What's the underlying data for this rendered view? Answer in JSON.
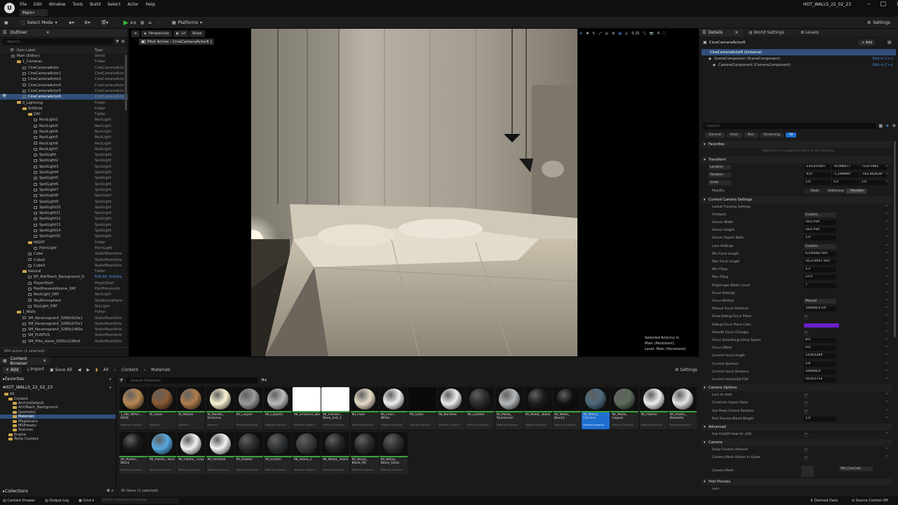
{
  "app": {
    "menu": [
      "File",
      "Edit",
      "Window",
      "Tools",
      "Build",
      "Select",
      "Actor",
      "Help"
    ],
    "level_tab": "Main•",
    "project_name": "HOT_WALLS_22_02_23"
  },
  "toolbar": {
    "select_mode": "Select Mode",
    "platforms": "Platforms",
    "settings": "Settings"
  },
  "outliner": {
    "tab": "Outliner",
    "search_placeholder": "Search...",
    "col_label": "Item Label",
    "col_type": "Type",
    "footer": "804 actors (1 selected)",
    "rows": [
      {
        "name": "Main (Editor)",
        "type": "World",
        "indent": 0,
        "kind": "world"
      },
      {
        "name": "1_Cameras",
        "type": "Folder",
        "indent": 1,
        "kind": "folder"
      },
      {
        "name": "CineCameraActor",
        "type": "CineCameraActo",
        "indent": 2,
        "kind": "actor"
      },
      {
        "name": "CineCameraActor1",
        "type": "CineCameraActo",
        "indent": 2,
        "kind": "actor"
      },
      {
        "name": "CineCameraActor2",
        "type": "CineCameraActo",
        "indent": 2,
        "kind": "actor"
      },
      {
        "name": "CineCameraActor4",
        "type": "CineCameraActo",
        "indent": 2,
        "kind": "actor"
      },
      {
        "name": "CineCameraActor5",
        "type": "CineCameraActo",
        "indent": 2,
        "kind": "actor"
      },
      {
        "name": "CineCameraActor6",
        "type": "CineCameraActo",
        "indent": 2,
        "kind": "actor",
        "selected": true
      },
      {
        "name": "0_Lightning",
        "type": "Folder",
        "indent": 1,
        "kind": "folder"
      },
      {
        "name": "Artificial",
        "type": "Folder",
        "indent": 2,
        "kind": "folder"
      },
      {
        "name": "DAY",
        "type": "Folder",
        "indent": 3,
        "kind": "folder"
      },
      {
        "name": "RectLight2",
        "type": "RectLight",
        "indent": 4,
        "kind": "actor"
      },
      {
        "name": "RectLight3",
        "type": "RectLight",
        "indent": 4,
        "kind": "actor"
      },
      {
        "name": "RectLight4",
        "type": "RectLight",
        "indent": 4,
        "kind": "actor"
      },
      {
        "name": "RectLight5",
        "type": "RectLight",
        "indent": 4,
        "kind": "actor"
      },
      {
        "name": "RectLight6",
        "type": "RectLight",
        "indent": 4,
        "kind": "actor"
      },
      {
        "name": "RectLight7",
        "type": "RectLight",
        "indent": 4,
        "kind": "actor"
      },
      {
        "name": "SpotLight",
        "type": "SpotLight",
        "indent": 4,
        "kind": "actor"
      },
      {
        "name": "SpotLight2",
        "type": "SpotLight",
        "indent": 4,
        "kind": "actor"
      },
      {
        "name": "SpotLight3",
        "type": "SpotLight",
        "indent": 4,
        "kind": "actor"
      },
      {
        "name": "SpotLight4",
        "type": "SpotLight",
        "indent": 4,
        "kind": "actor"
      },
      {
        "name": "SpotLight5",
        "type": "SpotLight",
        "indent": 4,
        "kind": "actor"
      },
      {
        "name": "SpotLight6",
        "type": "SpotLight",
        "indent": 4,
        "kind": "actor"
      },
      {
        "name": "SpotLight7",
        "type": "SpotLight",
        "indent": 4,
        "kind": "actor"
      },
      {
        "name": "SpotLight8",
        "type": "SpotLight",
        "indent": 4,
        "kind": "actor"
      },
      {
        "name": "SpotLight9",
        "type": "SpotLight",
        "indent": 4,
        "kind": "actor"
      },
      {
        "name": "SpotLight10",
        "type": "SpotLight",
        "indent": 4,
        "kind": "actor"
      },
      {
        "name": "SpotLight11",
        "type": "SpotLight",
        "indent": 4,
        "kind": "actor"
      },
      {
        "name": "SpotLight12",
        "type": "SpotLight",
        "indent": 4,
        "kind": "actor"
      },
      {
        "name": "SpotLight13",
        "type": "SpotLight",
        "indent": 4,
        "kind": "actor"
      },
      {
        "name": "SpotLight14",
        "type": "SpotLight",
        "indent": 4,
        "kind": "actor"
      },
      {
        "name": "SpotLight15",
        "type": "SpotLight",
        "indent": 4,
        "kind": "actor"
      },
      {
        "name": "NIGHT",
        "type": "Folder",
        "indent": 3,
        "kind": "folder"
      },
      {
        "name": "PointLight",
        "type": "PointLight",
        "indent": 4,
        "kind": "actor"
      },
      {
        "name": "Cube",
        "type": "StaticMeshActo",
        "indent": 3,
        "kind": "actor"
      },
      {
        "name": "Cube2",
        "type": "StaticMeshActo",
        "indent": 3,
        "kind": "actor"
      },
      {
        "name": "Cube3",
        "type": "StaticMeshActo",
        "indent": 3,
        "kind": "actor"
      },
      {
        "name": "Natural",
        "type": "Folder",
        "indent": 2,
        "kind": "folder"
      },
      {
        "name": "BP_ArbiTeach_Background_D",
        "type": "Edit BP_ArbiTea",
        "indent": 3,
        "kind": "actor",
        "link": true
      },
      {
        "name": "PlayerStart",
        "type": "PlayerStart",
        "indent": 3,
        "kind": "actor"
      },
      {
        "name": "PostProcessVolume_DAY",
        "type": "PostProcessVo",
        "indent": 3,
        "kind": "actor"
      },
      {
        "name": "RectLight_DAY",
        "type": "RectLight",
        "indent": 3,
        "kind": "actor"
      },
      {
        "name": "SkyAtmosphere",
        "type": "SkyAtmosphere",
        "indent": 3,
        "kind": "actor"
      },
      {
        "name": "SkyLight_DAY",
        "type": "SkyLight",
        "indent": 3,
        "kind": "actor"
      },
      {
        "name": "1_Walls",
        "type": "Folder",
        "indent": 1,
        "kind": "folder"
      },
      {
        "name": "SM_Keramogranit_3280x920x1",
        "type": "StaticMeshActo",
        "indent": 2,
        "kind": "actor"
      },
      {
        "name": "SM_Keramogranit_3280x970x1",
        "type": "StaticMeshActo",
        "indent": 2,
        "kind": "actor"
      },
      {
        "name": "SM_Keramogranit_3280x1460x",
        "type": "StaticMeshActo",
        "indent": 2,
        "kind": "actor"
      },
      {
        "name": "SM_PLINTUS",
        "type": "StaticMeshActo",
        "indent": 2,
        "kind": "actor"
      },
      {
        "name": "SM_Plita_stene_2500x1290x4",
        "type": "StaticMeshActo",
        "indent": 2,
        "kind": "actor"
      }
    ]
  },
  "viewport": {
    "perspective": "Perspective",
    "lit": "Lit",
    "show": "Show",
    "pilot_label": "[ Pilot Active - CineCameraActor6 ]",
    "snap_value": "0.25",
    "cam_speed": "4",
    "selected_actors": "Selected Actor(s) in",
    "persistent": "Main (Persistent)",
    "level_label": "Level:  Main (Persistent)"
  },
  "details": {
    "tabs": [
      "Details",
      "World Settings",
      "Levels"
    ],
    "add_label": "+ Add",
    "actor_name": "CineCameraActor6",
    "instance_label": "CineCameraActor6 (Instance)",
    "components": [
      {
        "name": "SceneComponent (SceneComponent)",
        "action": "Edit in C++"
      },
      {
        "name": "CameraComponent (CameraComponent)",
        "action": "Edit in C++"
      }
    ],
    "search_placeholder": "Search",
    "filters": [
      "General",
      "Actor",
      "Misc",
      "Streaming",
      "All"
    ],
    "favorites_hint": "Right-click on a property to add it to your Favorites.",
    "sections": [
      {
        "title": "Favorites"
      },
      {
        "title": "Transform"
      },
      {
        "title": "Current Camera Settings"
      },
      {
        "title": "Camera Options"
      },
      {
        "title": "Advanced"
      },
      {
        "title": "Camera"
      },
      {
        "title": "Post Process"
      }
    ],
    "transform": {
      "location_label": "Location",
      "rotation_label": "Rotation",
      "scale_label": "Scale",
      "mobility_label": "Mobility",
      "location": [
        "-234,615007",
        "76,986677",
        "75,875962"
      ],
      "rotation": [
        "-0,0°",
        "-1,199999°",
        "-162,902628°"
      ],
      "scale": [
        "1,0",
        "1,0",
        "1,0"
      ],
      "mobility": [
        "Static",
        "Stationary",
        "Movable"
      ]
    },
    "camera_rows": [
      {
        "label": "Lookat Tracking Settings",
        "value": ""
      },
      {
        "label": "Filmback",
        "value": "Custom..."
      },
      {
        "label": "Sensor Width",
        "value": "16,0 mm"
      },
      {
        "label": "Sensor Height",
        "value": "16,0 mm"
      },
      {
        "label": "Sensor Aspect Ratio",
        "value": "1,0"
      },
      {
        "label": "Lens Settings",
        "value": "Custom..."
      },
      {
        "label": "Min Focal Length",
        "value": "6,100002 mm"
      },
      {
        "label": "Max Focal Length",
        "value": "16,279597 mm"
      },
      {
        "label": "Min FStop",
        "value": "1,2"
      },
      {
        "label": "Max FStop",
        "value": "22,0"
      },
      {
        "label": "Diaphragm Blade Count",
        "value": "7"
      },
      {
        "label": "Focus Settings",
        "value": ""
      },
      {
        "label": "Focus Method",
        "value": "Manual"
      },
      {
        "label": "Manual Focus Distance",
        "value": "100000,0 cm"
      },
      {
        "label": "Draw Debug Focus Plane",
        "value": ""
      },
      {
        "label": "Debug Focus Plane Color",
        "value": ""
      },
      {
        "label": "Smooth Focus Changes",
        "value": ""
      },
      {
        "label": "Focus Smoothing Interp Speed",
        "value": "8,0"
      },
      {
        "label": "Focus Offset",
        "value": "0,0"
      },
      {
        "label": "Current Focal Length",
        "value": "14,601284"
      },
      {
        "label": "Current Aperture",
        "value": "2,8"
      },
      {
        "label": "Current Focus Distance",
        "value": "100000,0"
      },
      {
        "label": "Current Horizontal FOV",
        "value": "50,415733"
      }
    ],
    "options_rows": [
      {
        "label": "Lock to Hmd",
        "checked": true
      },
      {
        "label": "Constrain Aspect Ratio",
        "checked": true
      },
      {
        "label": "Use Pawn Control Rotation",
        "checked": true
      },
      {
        "label": "Post Process Blend Weight",
        "value": "1,0"
      }
    ],
    "advanced_rows": [
      {
        "label": "Use FieldOf View for LOD",
        "checked": true
      }
    ],
    "camera2_rows": [
      {
        "label": "Draw Frustum Allowed",
        "checked": true
      },
      {
        "label": "Camera Mesh Hidden In Game",
        "checked": true
      },
      {
        "label": "Camera Mesh",
        "value": "SM_CineCam"
      }
    ],
    "post_process_rows": [
      {
        "label": "Lens"
      }
    ]
  },
  "content_browser": {
    "tab": "Content Browser",
    "add": "+ Add",
    "import": "Import",
    "save_all": "Save All",
    "path": [
      "All",
      "Content",
      "Materials"
    ],
    "settings": "Settings",
    "favorites": "Favorites",
    "project": "HOT_WALLS_22_02_23",
    "search_placeholder": "Search Materials",
    "tree": [
      {
        "name": "All",
        "indent": 0
      },
      {
        "name": "Content",
        "indent": 1
      },
      {
        "name": "ArchvisDefault",
        "indent": 2
      },
      {
        "name": "ArhiTeach_Background",
        "indent": 2
      },
      {
        "name": "Geometry",
        "indent": 2
      },
      {
        "name": "Materials",
        "indent": 2,
        "selected": true
      },
      {
        "name": "Megascans",
        "indent": 2
      },
      {
        "name": "MSPresets",
        "indent": 2
      },
      {
        "name": "Textures",
        "indent": 2
      },
      {
        "name": "Engine",
        "indent": 1
      },
      {
        "name": "Temp Content",
        "indent": 1
      }
    ],
    "collections": "Collections",
    "footer": "30 items (1 selected)",
    "assets": [
      {
        "name": "1_MR_MAST... BASE",
        "sub": "Material Instance",
        "color": "#b98a55"
      },
      {
        "name": "M_Glass",
        "sub": "Material",
        "color": "#8a5a33"
      },
      {
        "name": "M_Master",
        "sub": "Material",
        "color": "#b07d4f"
      },
      {
        "name": "M_Master_ Emissive",
        "sub": "Material",
        "color": "#fff6d6"
      },
      {
        "name": "MI_Carpet",
        "sub": "Material Instance",
        "color": "#9a9a9a"
      },
      {
        "name": "MI_Carpet1",
        "sub": "Material Instance",
        "color": "#bcbcbc"
      },
      {
        "name": "MI_Emissive_Base_Inst",
        "sub": "Material Instance",
        "color": "#ffffff"
      },
      {
        "name": "MI_Emissiv... Base_Inst_1",
        "sub": "Material Instance",
        "color": "#ffffff"
      },
      {
        "name": "MI_Floor",
        "sub": "Material Instance",
        "color": "#e8dcc7"
      },
      {
        "name": "MI_Floor... White",
        "sub": "Material Instance",
        "color": "#f0f0f0"
      },
      {
        "name": "MI_Glass",
        "sub": "Material Instance",
        "color": "#0a0a0a"
      },
      {
        "name": "MI_Keramik",
        "sub": "Material Instance",
        "color": "#ededed"
      },
      {
        "name": "MI_Leather",
        "sub": "Material Instance",
        "color": "#2b2b2b"
      },
      {
        "name": "MI_Metal_ Aluminium",
        "sub": "Material Instance",
        "color": "#b5b8bb"
      },
      {
        "name": "MI_Metal_ Black",
        "sub": "Material Instance",
        "color": "#1b1b1b"
      },
      {
        "name": "MI_Metal_ Black1",
        "sub": "Material Instance",
        "color": "#111111"
      },
      {
        "name": "MI_Metal_ Chrome",
        "sub": "Material Instance",
        "color": "#4d6a7d",
        "selected": true
      },
      {
        "name": "MI_Metal_ Copper",
        "sub": "Material Instance",
        "color": "#5c6b5c"
      },
      {
        "name": "MI_Platinn",
        "sub": "Material Instance",
        "color": "#efefef"
      },
      {
        "name": "MI_Plastic_ Beamdiv",
        "sub": "Material Instance",
        "color": "#e6e6e6"
      },
      {
        "name": "MI_Plastic_ Black",
        "sub": "Material Instance",
        "color": "#1a1a1a"
      },
      {
        "name": "MI_Plastic_ Blue",
        "sub": "Material Instance",
        "color": "#58a9e0"
      },
      {
        "name": "MI_Plastic_ Gray",
        "sub": "Material Instance",
        "color": "#f2f2f2"
      },
      {
        "name": "MI_Portelok",
        "sub": "Material Instance",
        "color": "#f4f4f4"
      },
      {
        "name": "MI_Rubber",
        "sub": "Material Instance",
        "color": "#2a2a2a"
      },
      {
        "name": "MI_Screen",
        "sub": "Material Instance",
        "color": "#2e3134"
      },
      {
        "name": "MI_Stone_2",
        "sub": "Material Instance",
        "color": "#3a3a3a"
      },
      {
        "name": "MI_Wood_ Black",
        "sub": "Material Instance",
        "color": "#252525"
      },
      {
        "name": "MI_Wood_ Black_90",
        "sub": "Material Instance",
        "color": "#2b2b2b"
      },
      {
        "name": "MI_Wood_ Black_Gloss",
        "sub": "Material Instance",
        "color": "#303030"
      }
    ]
  },
  "statusbar": {
    "content_drawer": "Content Drawer",
    "output_log": "Output Log",
    "cmd": "Cmd",
    "cmd_placeholder": "Enter Console Command",
    "derived_data": "Derived Data",
    "source_control": "Source Control Off"
  },
  "colors": {
    "accent": "#2f4f7a",
    "selected_tile": "#1f6fd1",
    "play_green": "#3dbf3d",
    "folder": "#c9a54a"
  }
}
